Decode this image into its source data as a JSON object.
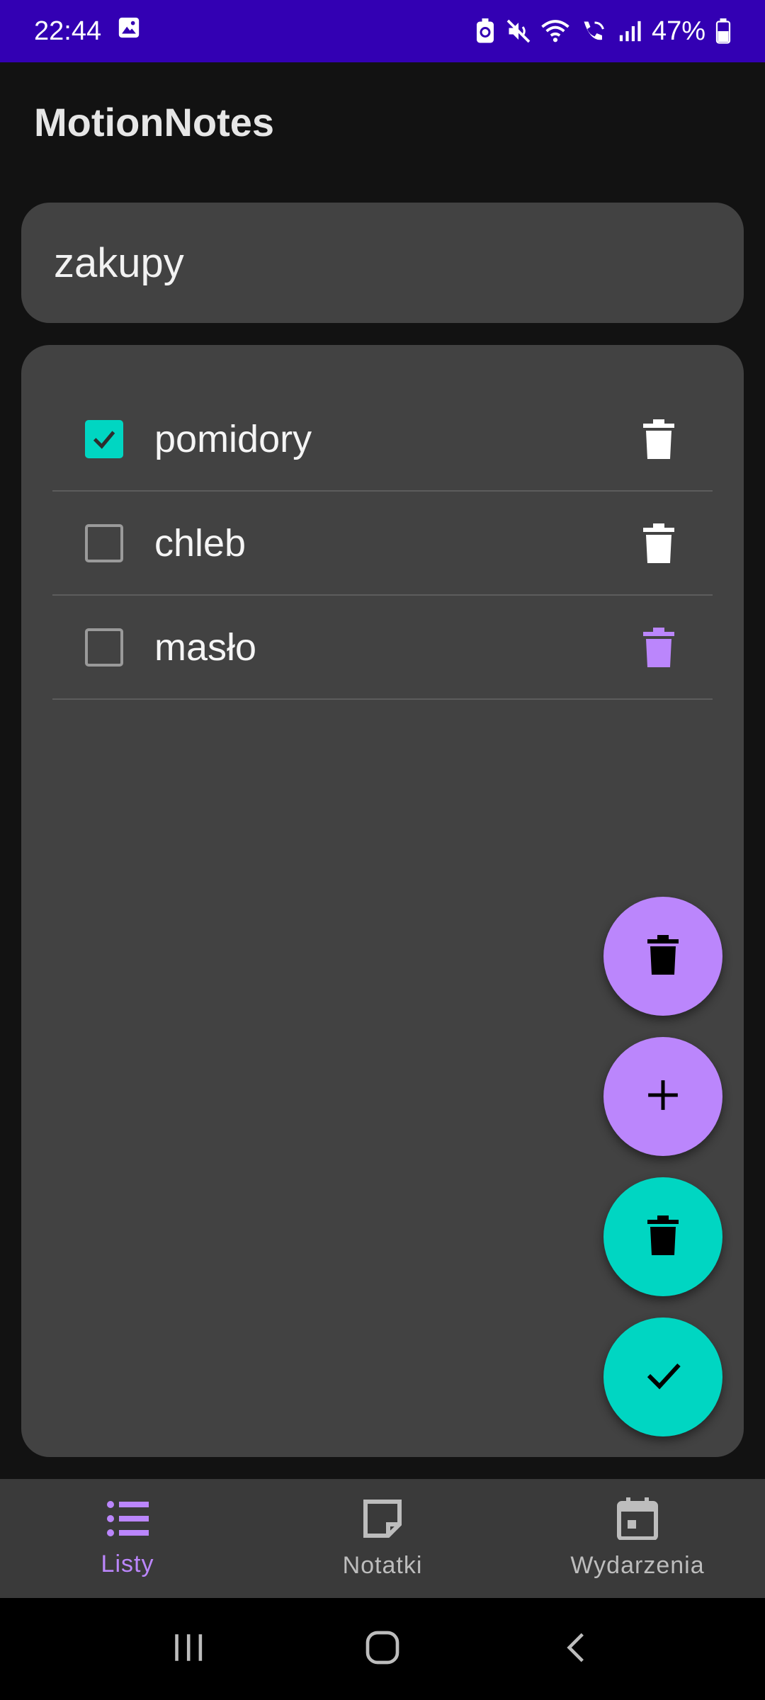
{
  "status_bar": {
    "time": "22:44",
    "battery": "47%",
    "icons": [
      "gallery-icon",
      "battery-saver-icon",
      "mute-icon",
      "wifi-icon",
      "wifi-calling-icon",
      "signal-icon",
      "battery-icon"
    ],
    "background": "#3300b3"
  },
  "app": {
    "title": "MotionNotes"
  },
  "list": {
    "title_value": "zakupy",
    "items": [
      {
        "label": "pomidory",
        "checked": true,
        "delete_icon_color": "#ffffff"
      },
      {
        "label": "chleb",
        "checked": false,
        "delete_icon_color": "#ffffff"
      },
      {
        "label": "masło",
        "checked": false,
        "delete_icon_color": "#bb86fc"
      }
    ]
  },
  "fabs": [
    {
      "name": "delete-list-fab",
      "icon": "trash-icon",
      "color": "#bb86fc"
    },
    {
      "name": "add-item-fab",
      "icon": "plus-icon",
      "color": "#bb86fc"
    },
    {
      "name": "delete-checked-fab",
      "icon": "trash-icon",
      "color": "#00d6c2"
    },
    {
      "name": "save-fab",
      "icon": "check-icon",
      "color": "#00d6c2"
    }
  ],
  "bottom_nav": {
    "items": [
      {
        "label": "Listy",
        "icon": "list-icon",
        "active": true
      },
      {
        "label": "Notatki",
        "icon": "note-icon",
        "active": false
      },
      {
        "label": "Wydarzenia",
        "icon": "calendar-icon",
        "active": false
      }
    ]
  },
  "system_nav": {
    "buttons": [
      "recent-apps-icon",
      "home-icon",
      "back-icon"
    ]
  },
  "colors": {
    "accent_purple": "#bb86fc",
    "accent_teal": "#00d6c2",
    "card": "#424242",
    "background": "#121212"
  }
}
